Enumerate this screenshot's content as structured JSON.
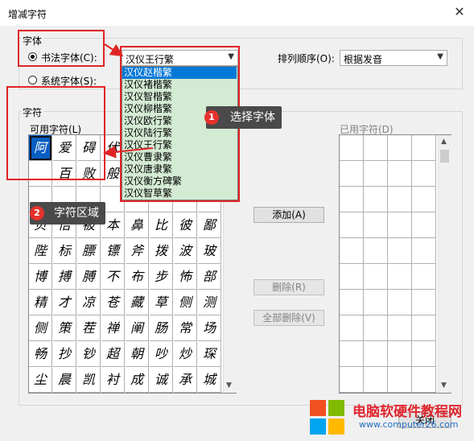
{
  "window": {
    "title": "增减字符",
    "close_glyph": "✕"
  },
  "font_group": {
    "label": "字体",
    "calligraphy_radio": "书法字体(C):",
    "system_radio": "系统字体(S):",
    "selected_font": "汉仪王行繁",
    "options": [
      "汉仪赵楷繁",
      "汉仪褚楷繁",
      "汉仪智楷繁",
      "汉仪柳楷繁",
      "汉仪欧行繁",
      "汉仪陆行繁",
      "汉仪王行繁",
      "汉仪曹隶繁",
      "汉仪唐隶繁",
      "汉仪衡方碑繁",
      "汉仪智草繁"
    ]
  },
  "sort": {
    "label": "排列顺序(O):",
    "value": "根据发音"
  },
  "chars_group": {
    "label": "字符",
    "available_label": "可用字符(L)",
    "used_label": "已用字符(D)",
    "rows": [
      [
        "阿",
        "爱",
        "碍",
        "伏",
        "",
        "",
        "",
        "",
        ""
      ],
      [
        "",
        "百",
        "败",
        "般",
        "",
        "",
        "",
        "",
        ""
      ],
      [
        "",
        "",
        "",
        "",
        "",
        "",
        "",
        "",
        ""
      ],
      [
        "贝",
        "倍",
        "被",
        "本",
        "鼻",
        "比",
        "彼",
        "鄙",
        ""
      ],
      [
        "陛",
        "标",
        "膘",
        "镖",
        "斧",
        "拨",
        "波",
        "玻",
        ""
      ],
      [
        "博",
        "搏",
        "膊",
        "不",
        "布",
        "步",
        "怖",
        "部",
        ""
      ],
      [
        "精",
        "才",
        "凉",
        "苍",
        "藏",
        "草",
        "侧",
        "测",
        ""
      ],
      [
        "侧",
        "策",
        "茬",
        "禅",
        "阐",
        "肠",
        "常",
        "场",
        ""
      ],
      [
        "畅",
        "抄",
        "钞",
        "超",
        "朝",
        "吵",
        "炒",
        "琛",
        ""
      ],
      [
        "尘",
        "晨",
        "凯",
        "衬",
        "成",
        "诚",
        "承",
        "城",
        ""
      ]
    ]
  },
  "buttons": {
    "add": "添加(A)",
    "delete": "删除(R)",
    "delete_all": "全部删除(V)",
    "close": "关闭"
  },
  "annotations": {
    "one_num": "1",
    "one_text": "选择字体",
    "two_num": "2",
    "two_text": "字符区域"
  },
  "watermark": {
    "title": "电脑软硬件教程网",
    "url": "www.computer26.com"
  },
  "colors": {
    "accent": "#0078d7",
    "annotation_red": "#e02424",
    "list_bg": "#d3ead3"
  }
}
